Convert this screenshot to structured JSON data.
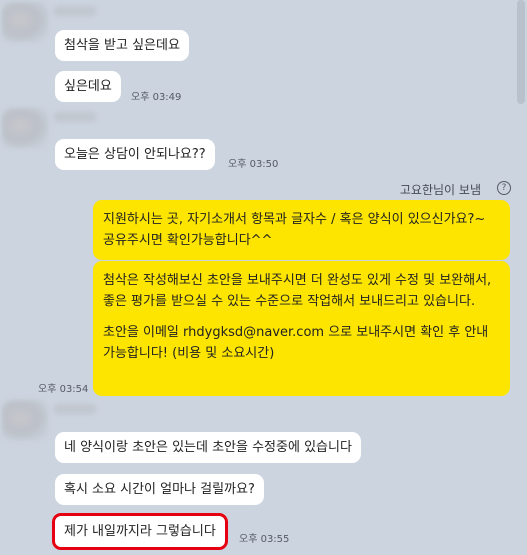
{
  "messages": [
    {
      "text": "첨삭을 받고 싶은데요"
    },
    {
      "text": "싶은데요",
      "time": "오후 03:49"
    },
    {
      "text": "오늘은 상담이 안되나요??",
      "time": "오후 03:50"
    },
    {
      "sender": "고요한님이 보냄"
    },
    {
      "text": "지원하시는 곳, 자기소개서 항목과 글자수 / 혹은 양식이 있으신가요?~ 공유주시면 확인가능합니다^^"
    },
    {
      "p1": "첨삭은 작성해보신 초안을 보내주시면 더 완성도 있게 수정 및 보완해서, 좋은 평가를 받으실 수 있는 수준으로 작업해서 보내드리고 있습니다.",
      "p2": "초안을 이메일 rhdygksd@naver.com 으로 보내주시면 확인 후 안내 가능합니다! (비용 및 소요시간)",
      "time": "오후 03:54"
    },
    {
      "text": "네 양식이랑 초안은 있는데 초안을 수정중에 있습니다"
    },
    {
      "text": "혹시 소요 시간이 얼마나 걸릴까요?"
    },
    {
      "text": "제가 내일까지라 그렇습니다",
      "time": "오후 03:55"
    }
  ],
  "help_glyph": "?"
}
